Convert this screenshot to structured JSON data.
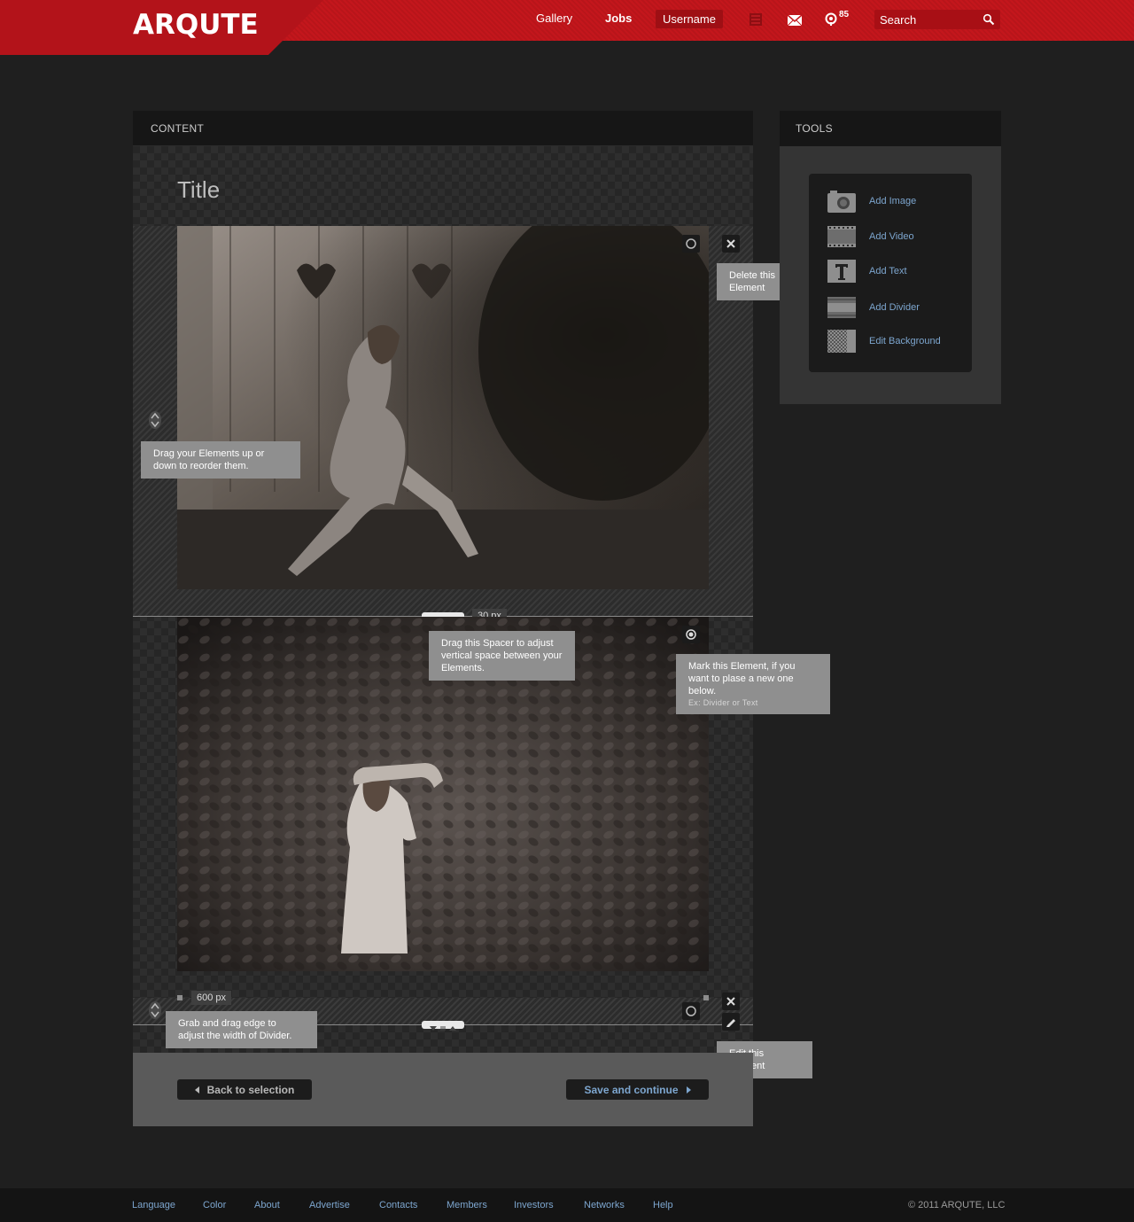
{
  "header": {
    "logo": "ARQUTE",
    "nav": {
      "gallery": "Gallery",
      "jobs": "Jobs",
      "username": "Username"
    },
    "notification_count": "85",
    "search_placeholder": "Search",
    "brand_color": "#c4161c"
  },
  "content_panel": {
    "heading": "CONTENT",
    "title": "Title",
    "spacer_value": "30 px",
    "divider_width": "600 px",
    "back_button": "Back to selection",
    "save_button": "Save and continue"
  },
  "tooltips": {
    "delete": "Delete this Element",
    "drag": "Drag your Elements up or down to reorder them.",
    "spacer": "Drag this Spacer to adjust vertical space between your Elements.",
    "mark": "Mark this Element, if you want to plase a new one below.",
    "mark_hint": "Ex: Divider or Text",
    "divider": "Grab and drag edge to adjust the width of Divider.",
    "edit": "Edit this Element"
  },
  "tools": {
    "heading": "TOOLS",
    "items": [
      {
        "label": "Add Image",
        "icon": "camera-icon"
      },
      {
        "label": "Add Video",
        "icon": "film-icon"
      },
      {
        "label": "Add Text",
        "icon": "text-icon"
      },
      {
        "label": "Add Divider",
        "icon": "divider-icon"
      },
      {
        "label": "Edit Background",
        "icon": "background-icon"
      }
    ]
  },
  "footer": {
    "links": [
      "Language",
      "Color",
      "About",
      "Advertise",
      "Contacts",
      "Members",
      "Investors",
      "Networks",
      "Help"
    ],
    "copyright": "© 2011 ARQUTE, LLC"
  }
}
